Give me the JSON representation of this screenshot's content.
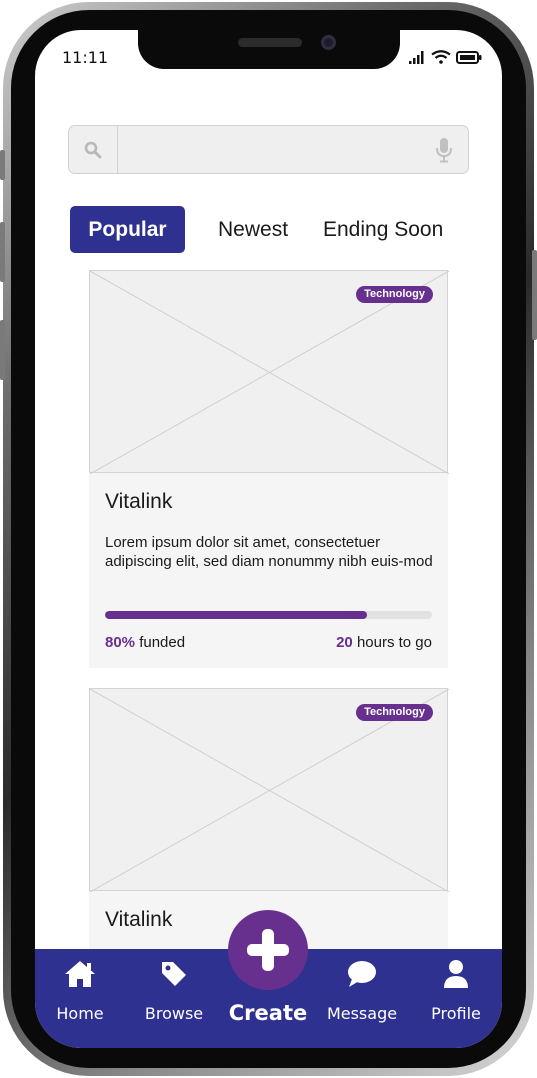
{
  "status_bar": {
    "time": "11:11"
  },
  "search": {
    "placeholder": ""
  },
  "tabs": [
    {
      "label": "Popular",
      "active": true
    },
    {
      "label": "Newest",
      "active": false
    },
    {
      "label": "Ending Soon",
      "active": false
    }
  ],
  "cards": [
    {
      "category": "Technology",
      "title": "Vitalink",
      "description": "Lorem ipsum dolor sit amet, consectetuer adipiscing elit, sed diam nonummy nibh euis-mod",
      "funded_percent": "80%",
      "funded_label": "funded",
      "funded_fraction": 0.8,
      "hours": "20",
      "hours_label": "hours to go"
    },
    {
      "category": "Technology",
      "title": "Vitalink"
    }
  ],
  "bottom_nav": {
    "home": {
      "label": "Home",
      "icon": "home-icon"
    },
    "browse": {
      "label": "Browse",
      "icon": "tag-icon"
    },
    "create": {
      "label": "Create",
      "icon": "plus-icon"
    },
    "message": {
      "label": "Message",
      "icon": "chat-bubble-icon"
    },
    "profile": {
      "label": "Profile",
      "icon": "user-icon"
    }
  },
  "colors": {
    "primary": "#2e3190",
    "accent": "#67308f",
    "progress_track": "#e2e2e2",
    "card_bg": "#f5f5f5"
  }
}
